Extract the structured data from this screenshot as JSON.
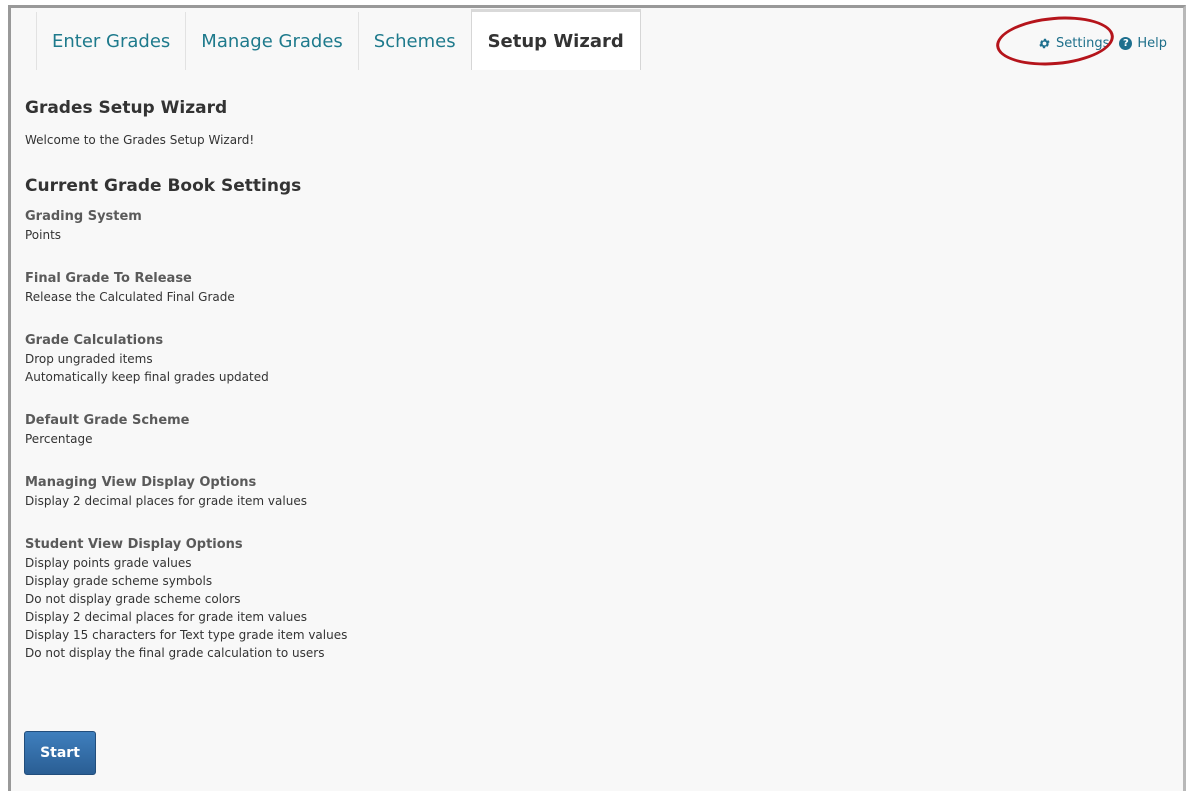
{
  "tabs": [
    {
      "label": "Enter Grades",
      "active": false
    },
    {
      "label": "Manage Grades",
      "active": false
    },
    {
      "label": "Schemes",
      "active": false
    },
    {
      "label": "Setup Wizard",
      "active": true
    }
  ],
  "topbar": {
    "settings_label": "Settings",
    "settings_icon": "gear-icon",
    "help_label": "Help",
    "help_icon": "help-icon",
    "annotation_color": "#b5141b"
  },
  "page": {
    "title": "Grades Setup Wizard",
    "welcome": "Welcome to the Grades Setup Wizard!",
    "section_title": "Current Grade Book Settings"
  },
  "settings": [
    {
      "label": "Grading System",
      "values": [
        "Points"
      ]
    },
    {
      "label": "Final Grade To Release",
      "values": [
        "Release the Calculated Final Grade"
      ]
    },
    {
      "label": "Grade Calculations",
      "values": [
        "Drop ungraded items",
        "Automatically keep final grades updated"
      ]
    },
    {
      "label": "Default Grade Scheme",
      "values": [
        "Percentage"
      ]
    },
    {
      "label": "Managing View Display Options",
      "values": [
        "Display 2 decimal places for grade item values"
      ]
    },
    {
      "label": "Student View Display Options",
      "values": [
        "Display points grade values",
        "Display grade scheme symbols",
        "Do not display grade scheme colors",
        "Display 2 decimal places for grade item values",
        "Display 15 characters for Text type grade item values",
        "Do not display the final grade calculation to users"
      ]
    }
  ],
  "actions": {
    "start_label": "Start"
  },
  "colors": {
    "link": "#1e7a8c",
    "button": "#2f6aa6"
  }
}
